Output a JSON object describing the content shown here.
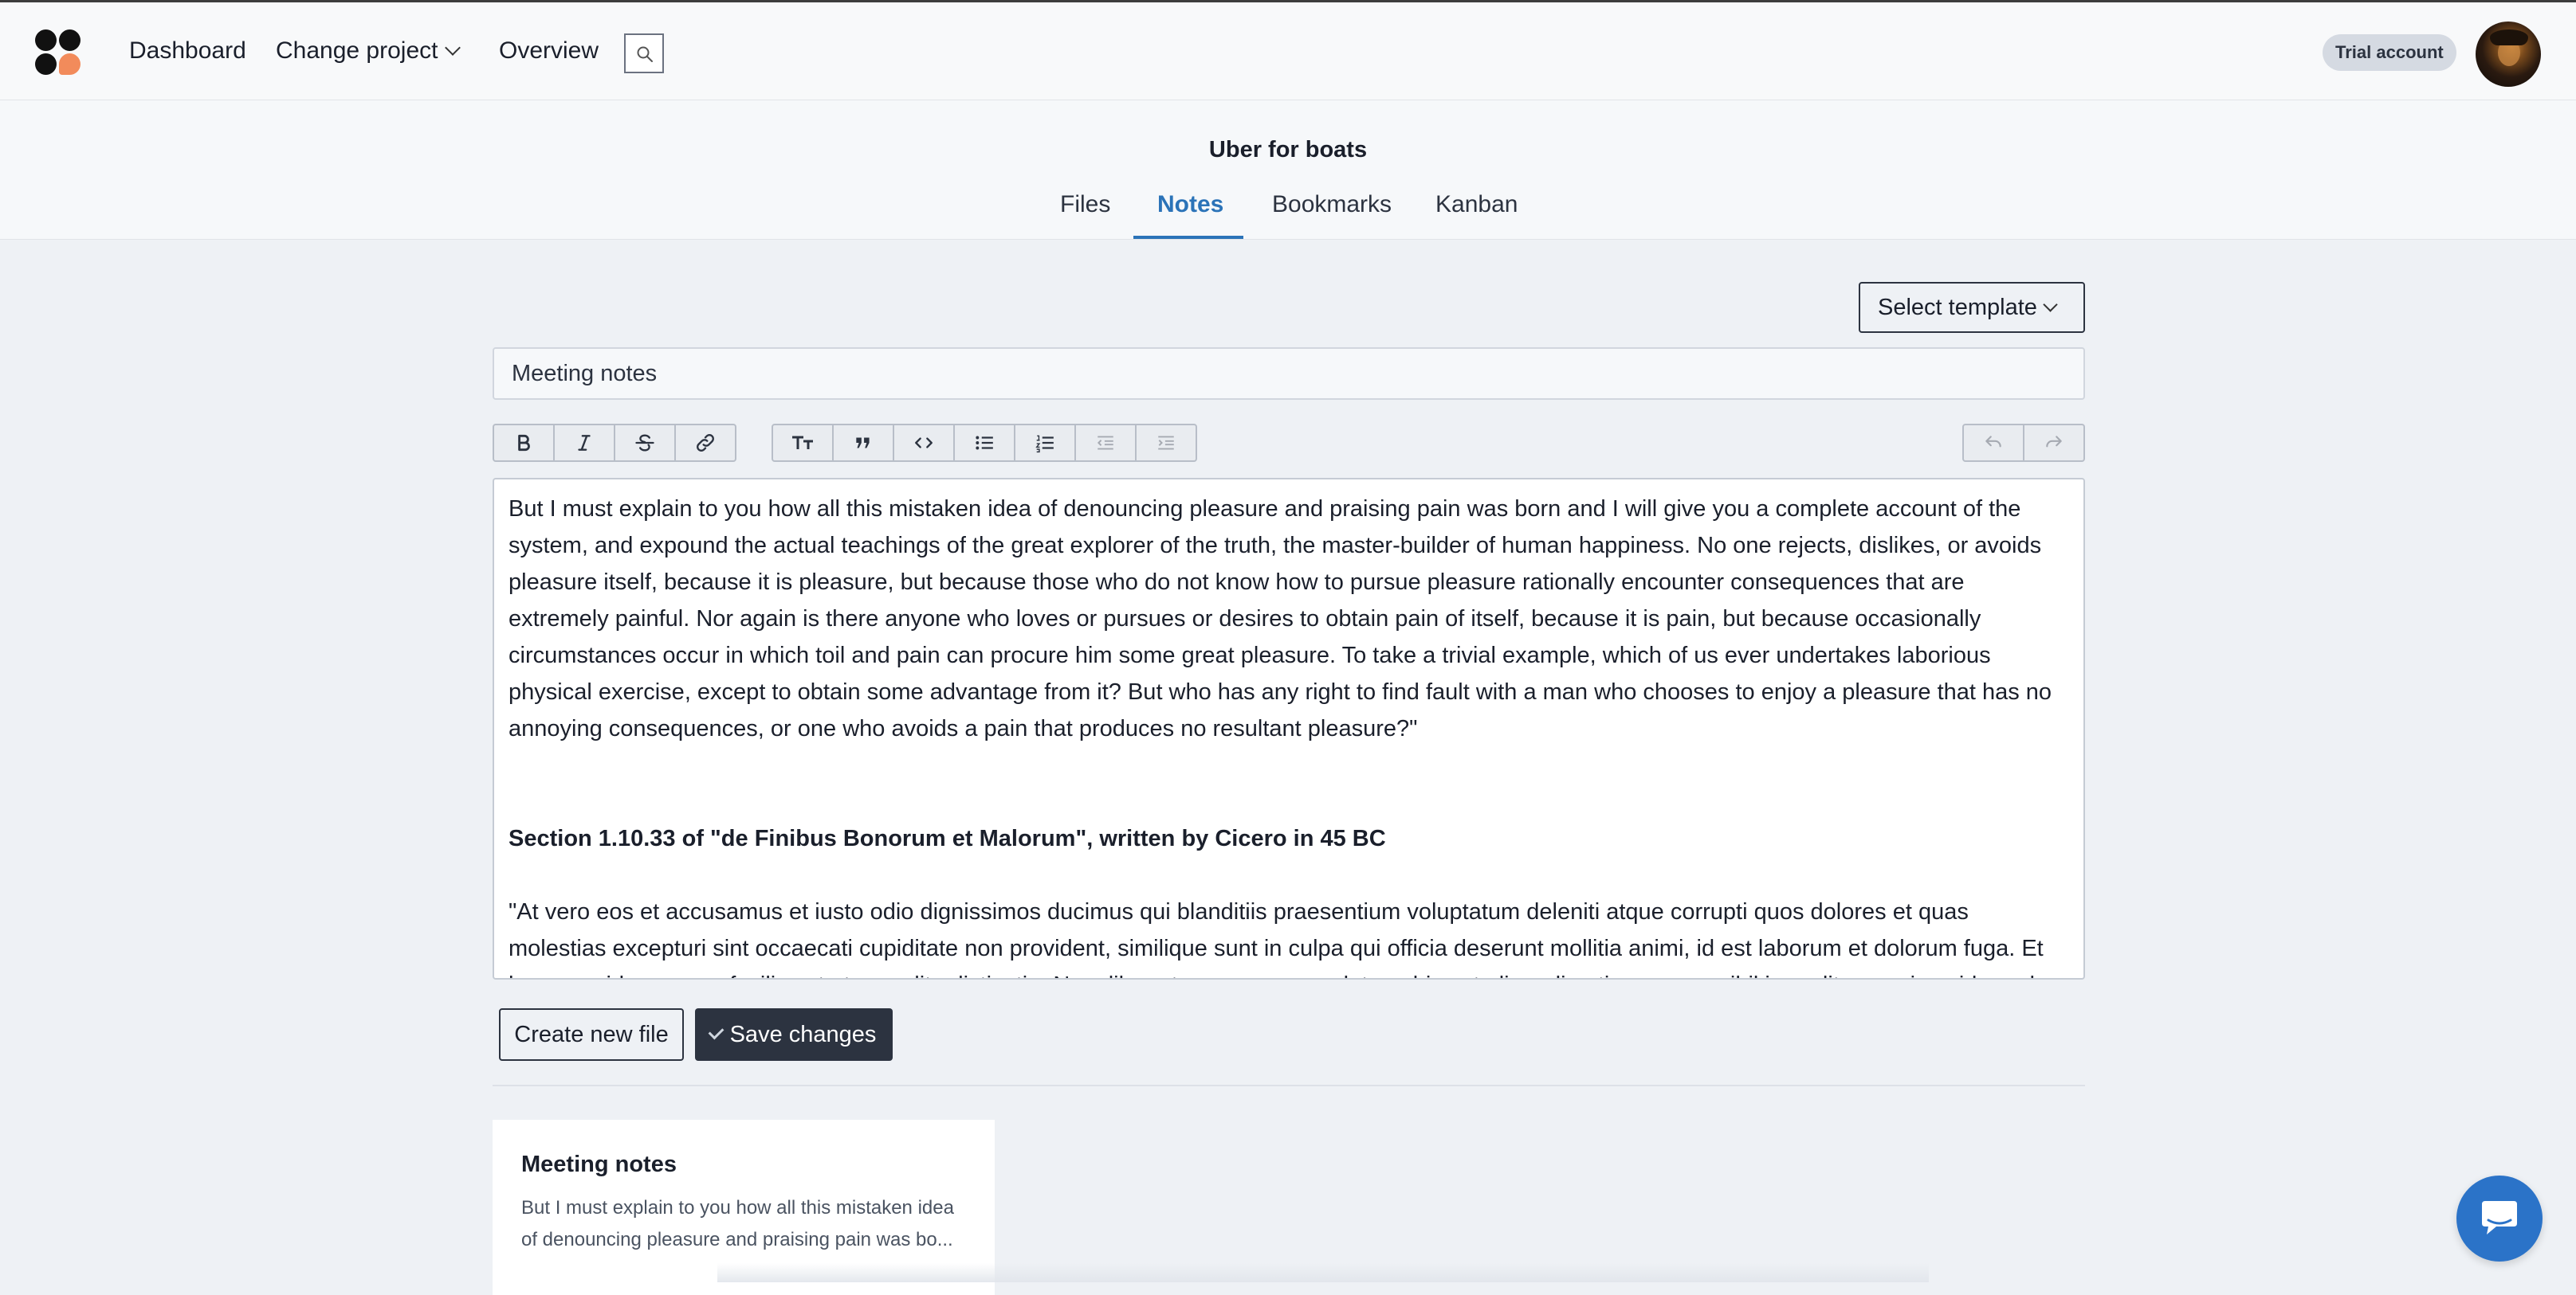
{
  "topbar": {
    "nav": {
      "dashboard": "Dashboard",
      "change_project": "Change project",
      "overview": "Overview"
    },
    "trial_badge": "Trial account"
  },
  "project": {
    "title": "Uber for boats",
    "tabs": [
      "Files",
      "Notes",
      "Bookmarks",
      "Kanban"
    ],
    "active_tab": "Notes"
  },
  "editor": {
    "select_template_label": "Select template",
    "title_value": "Meeting notes",
    "toolbar": {
      "formatting": [
        "bold-icon",
        "italic-icon",
        "strikethrough-icon",
        "link-icon"
      ],
      "blocks": [
        "heading-icon",
        "quote-icon",
        "code-icon",
        "bullet-list-icon",
        "numbered-list-icon",
        "outdent-icon",
        "indent-icon"
      ],
      "history": [
        "undo-icon",
        "redo-icon"
      ]
    },
    "body": {
      "paragraph1": "But I must explain to you how all this mistaken idea of denouncing pleasure and praising pain was born and I will give you a complete account of the system, and expound the actual teachings of the great explorer of the truth, the master-builder of human happiness. No one rejects, dislikes, or avoids pleasure itself, because it is pleasure, but because those who do not know how to pursue pleasure rationally encounter consequences that are extremely painful. Nor again is there anyone who loves or pursues or desires to obtain pain of itself, because it is pain, but because occasionally circumstances occur in which toil and pain can procure him some great pleasure. To take a trivial example, which of us ever undertakes laborious physical exercise, except to obtain some advantage from it? But who has any right to find fault with a man who chooses to enjoy a pleasure that has no annoying consequences, or one who avoids a pain that produces no resultant pleasure?\"",
      "heading": "Section 1.10.33 of \"de Finibus Bonorum et Malorum\", written by Cicero in 45 BC",
      "paragraph2": "\"At vero eos et accusamus et iusto odio dignissimos ducimus qui blanditiis praesentium voluptatum deleniti atque corrupti quos dolores et quas molestias excepturi sint occaecati cupiditate non provident, similique sunt in culpa qui officia deserunt mollitia animi, id est laborum et dolorum fuga. Et harum quidem rerum facilis est et expedita distinctio. Nam libero tempore, cum soluta nobis est eligendi optio cumque nihil impedit quo minus id quod maxime placeat"
    },
    "create_button": "Create new file",
    "save_button": "Save changes"
  },
  "notes_list": [
    {
      "title": "Meeting notes",
      "excerpt": "But I must explain to you how all this mistaken idea of denouncing pleasure and praising pain was bo..."
    }
  ],
  "colors": {
    "accent": "#2b73b8",
    "dark": "#2c3340",
    "logo_accent": "#f28b5b",
    "chat": "#2b73c8"
  }
}
